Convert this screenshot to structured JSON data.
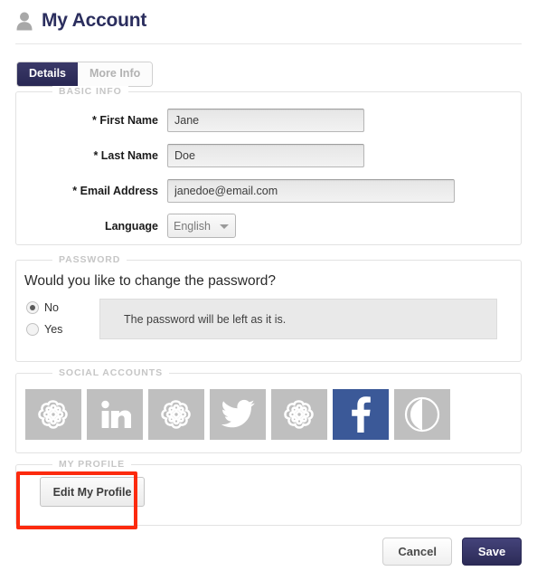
{
  "header": {
    "title": "My Account",
    "icon": "user-silhouette-icon"
  },
  "tabs": [
    {
      "label": "Details",
      "active": true
    },
    {
      "label": "More Info",
      "active": false
    }
  ],
  "sections": {
    "basic_info": {
      "legend": "BASIC INFO",
      "fields": [
        {
          "label": "* First Name",
          "value": "Jane"
        },
        {
          "label": "* Last Name",
          "value": "Doe"
        },
        {
          "label": "* Email Address",
          "value": "janedoe@email.com"
        }
      ],
      "language": {
        "label": "Language",
        "selected": "English",
        "options": [
          "English"
        ]
      }
    },
    "password": {
      "legend": "PASSWORD",
      "question": "Would you like to change the password?",
      "options": [
        {
          "label": "No",
          "selected": true
        },
        {
          "label": "Yes",
          "selected": false
        }
      ],
      "note": "The password will be left as it is."
    },
    "social_accounts": {
      "legend": "SOCIAL ACCOUNTS",
      "accounts": [
        {
          "icon": "flower-rosette-icon",
          "connected": false,
          "color": "#bfbfbf"
        },
        {
          "icon": "linkedin-icon",
          "connected": false,
          "color": "#bfbfbf"
        },
        {
          "icon": "flower-rosette-icon",
          "connected": false,
          "color": "#bfbfbf"
        },
        {
          "icon": "twitter-bird-icon",
          "connected": false,
          "color": "#bfbfbf"
        },
        {
          "icon": "flower-rosette-icon",
          "connected": false,
          "color": "#bfbfbf"
        },
        {
          "icon": "facebook-icon",
          "connected": true,
          "color": "#3b5998"
        },
        {
          "icon": "half-moon-circle-icon",
          "connected": false,
          "color": "#bfbfbf"
        }
      ]
    },
    "my_profile": {
      "legend": "MY PROFILE",
      "edit_button": "Edit My Profile",
      "highlight_color": "#fc2a0e"
    }
  },
  "footer": {
    "cancel_label": "Cancel",
    "save_label": "Save"
  }
}
